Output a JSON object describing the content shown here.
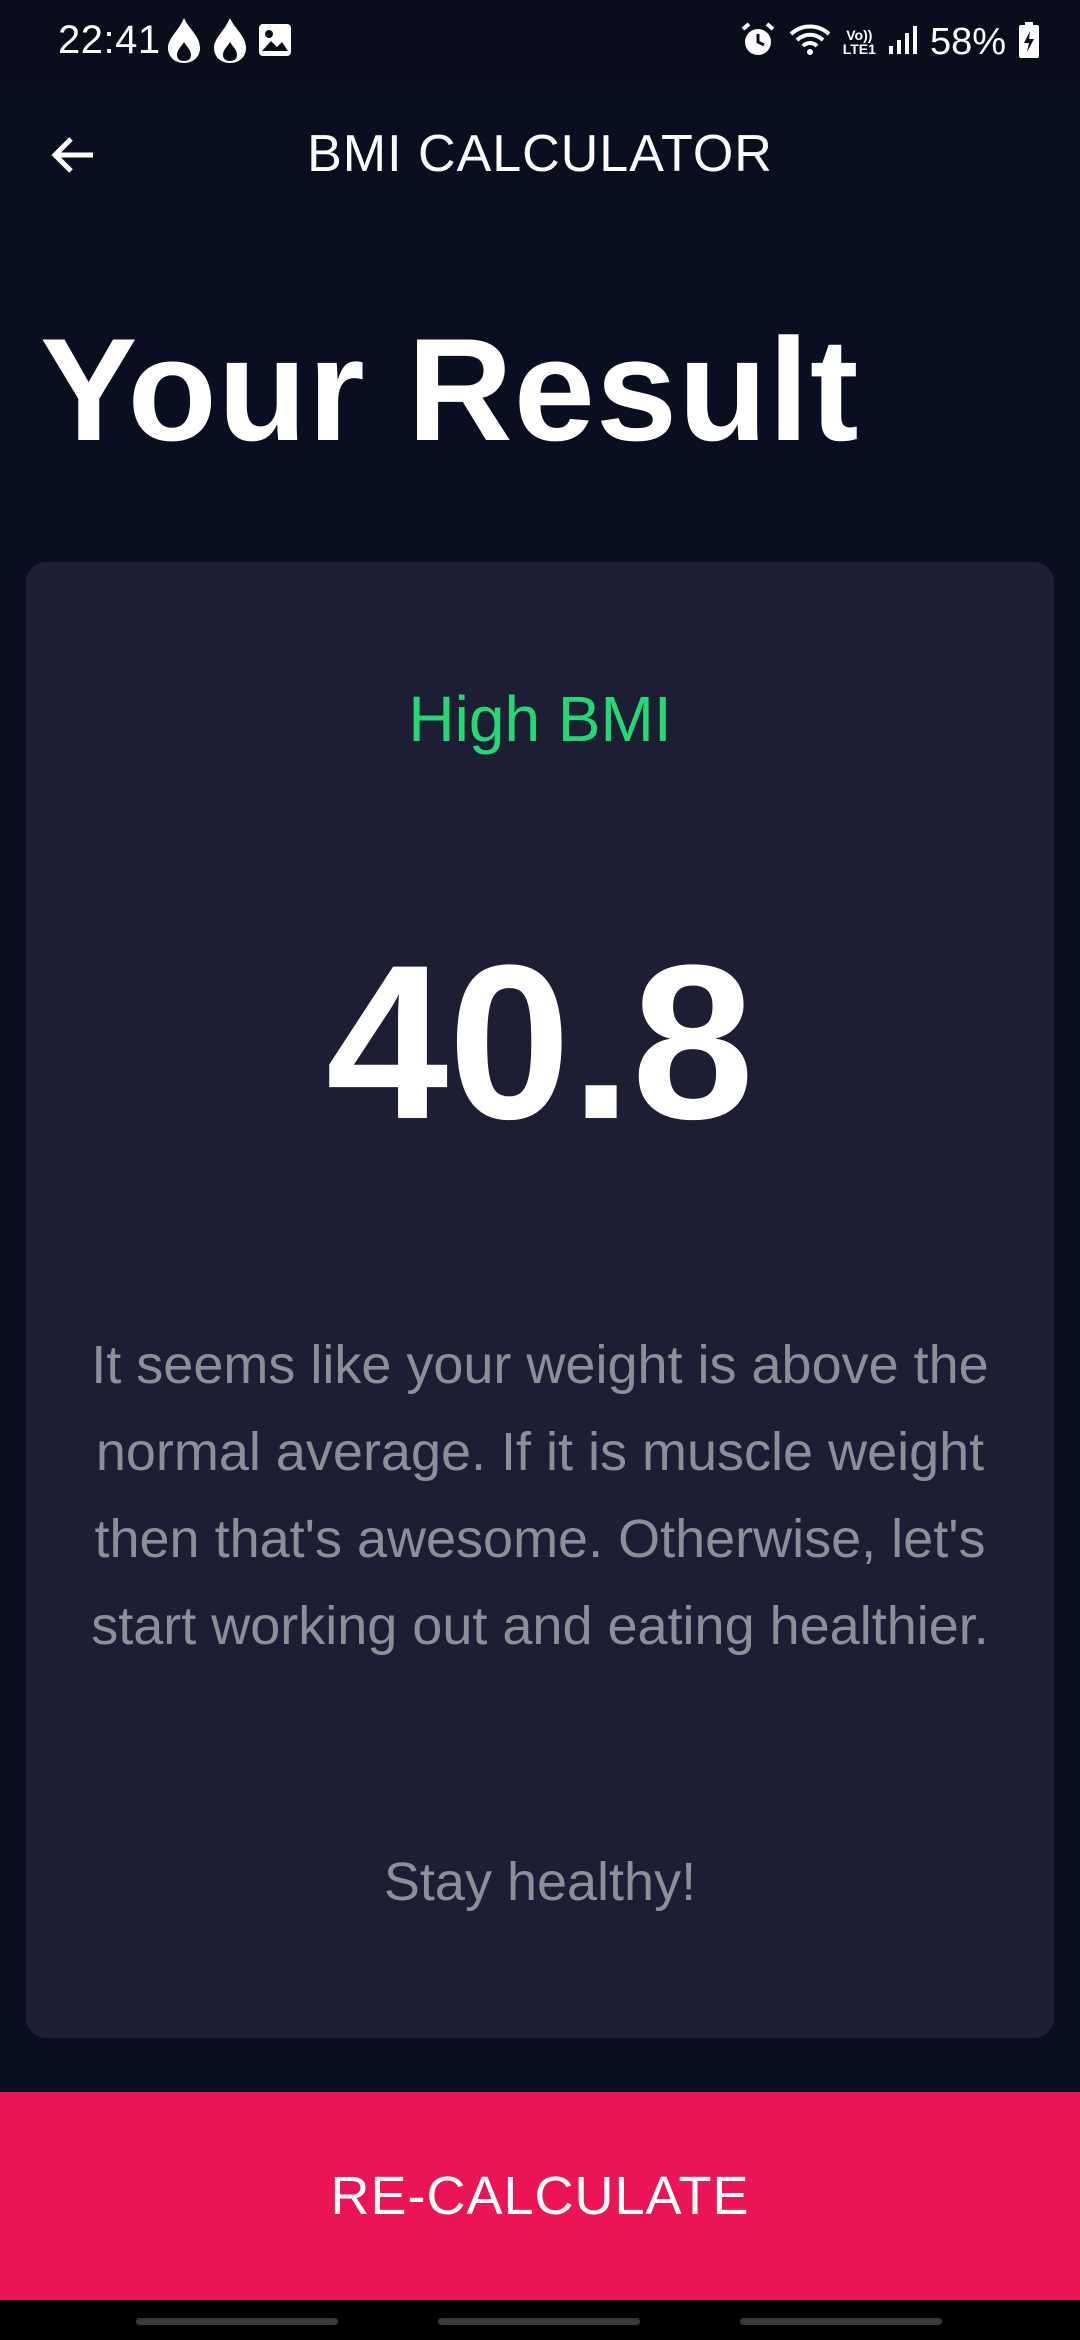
{
  "status_bar": {
    "time": "22:41",
    "battery": "58%",
    "lte_top": "Vo))",
    "lte_bottom": "LTE1",
    "left_icons": [
      "flame-icon",
      "flame-icon",
      "image-icon"
    ],
    "right_icons": [
      "alarm-icon",
      "wifi-icon",
      "signal-icon",
      "battery-icon"
    ]
  },
  "app_bar": {
    "title": "BMI CALCULATOR",
    "back_icon": "arrow-left-icon"
  },
  "headline": "Your Result",
  "result": {
    "status": "High BMI",
    "status_color": "#24d876",
    "value": "40.8",
    "interpretation": "It seems like your weight is above the normal average. If it is muscle weight then that's awesome. Otherwise, let's start working out and eating healthier.",
    "closing": "Stay healthy!"
  },
  "actions": {
    "recalculate_label": "RE-CALCULATE",
    "recalculate_color": "#eb1555"
  },
  "theme": {
    "background": "#0a0e21",
    "card": "#1d1e33",
    "muted_text": "#8d8e98"
  }
}
